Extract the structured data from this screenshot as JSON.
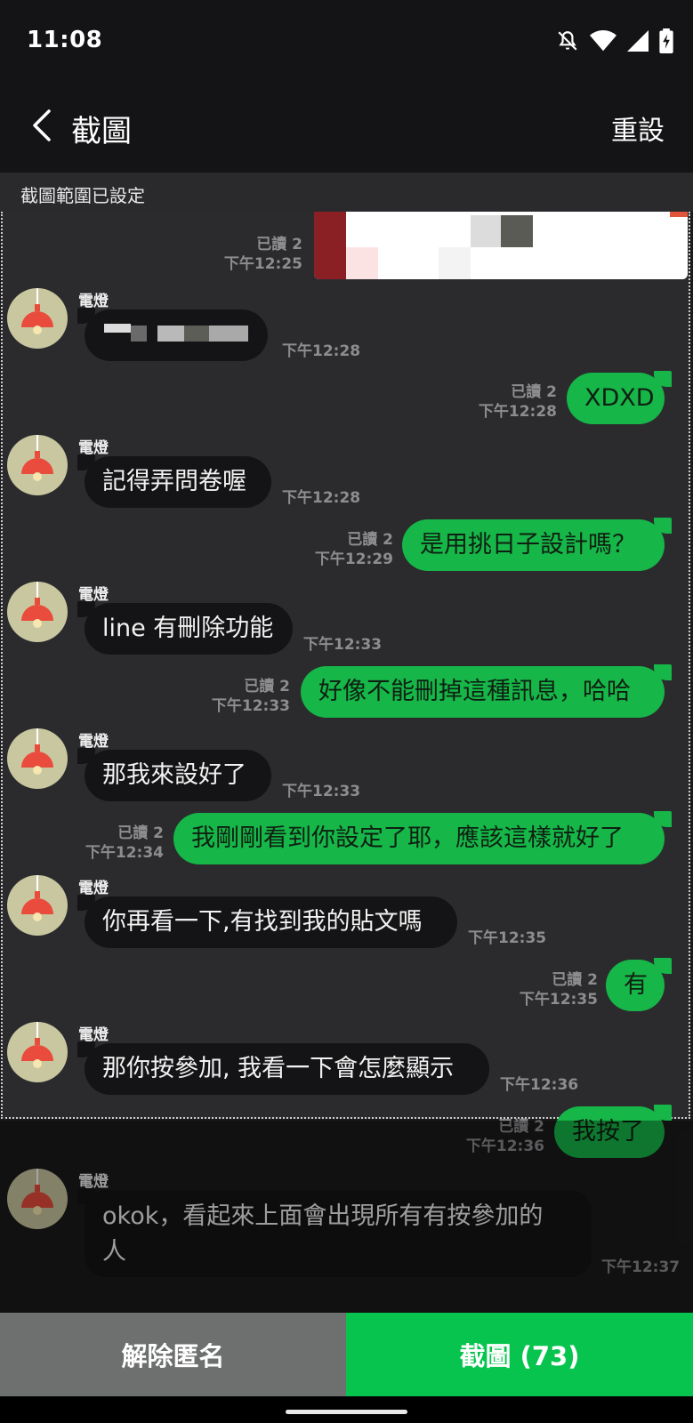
{
  "status": {
    "time": "11:08"
  },
  "header": {
    "title": "截圖",
    "reset_label": "重設"
  },
  "banner": {
    "text": "截圖範圍已設定"
  },
  "messages": [
    {
      "type": "out-image",
      "read": "已讀 2",
      "time": "下午12:25"
    },
    {
      "type": "in",
      "sender": "電燈",
      "text": "",
      "time": "下午12:28",
      "note": "pixelated"
    },
    {
      "type": "out",
      "read": "已讀 2",
      "text": "XDXD",
      "time": "下午12:28"
    },
    {
      "type": "in",
      "sender": "電燈",
      "text": "記得弄問卷喔",
      "time": "下午12:28"
    },
    {
      "type": "out",
      "read": "已讀 2",
      "text": "是用挑日子設計嗎？",
      "time": "下午12:29"
    },
    {
      "type": "in",
      "sender": "電燈",
      "text": "line 有刪除功能",
      "time": "下午12:33"
    },
    {
      "type": "out",
      "read": "已讀 2",
      "text": "好像不能刪掉這種訊息，哈哈",
      "time": "下午12:33"
    },
    {
      "type": "in",
      "sender": "電燈",
      "text": "那我來設好了",
      "time": "下午12:33"
    },
    {
      "type": "out",
      "read": "已讀 2",
      "text": "我剛剛看到你設定了耶，應該這樣就好了",
      "time": "下午12:34"
    },
    {
      "type": "in",
      "sender": "電燈",
      "text": "你再看一下,有找到我的貼文嗎",
      "time": "下午12:35"
    },
    {
      "type": "out",
      "read": "已讀 2",
      "text": "有",
      "time": "下午12:35"
    },
    {
      "type": "in",
      "sender": "電燈",
      "text": "那你按參加, 我看一下會怎麼顯示",
      "time": "下午12:36"
    },
    {
      "type": "out",
      "read": "已讀 2",
      "text": "我按了",
      "time": "下午12:36"
    },
    {
      "type": "in",
      "sender": "電燈",
      "text_line1": "okok，看起來上面會出現所有有按參加的",
      "text_line2": "人",
      "time": "下午12:37"
    }
  ],
  "bottom": {
    "anon_label": "解除匿名",
    "capture_label": "截圖 (73)"
  },
  "colors": {
    "bubble_out": "#16b648",
    "bubble_in": "#141416",
    "capture_btn": "#06c44e",
    "anon_btn": "#6e706f"
  },
  "icons": [
    "back-arrow-icon",
    "dnd-off-icon",
    "wifi-icon",
    "cellular-icon",
    "battery-charging-icon",
    "lamp-avatar-icon"
  ]
}
